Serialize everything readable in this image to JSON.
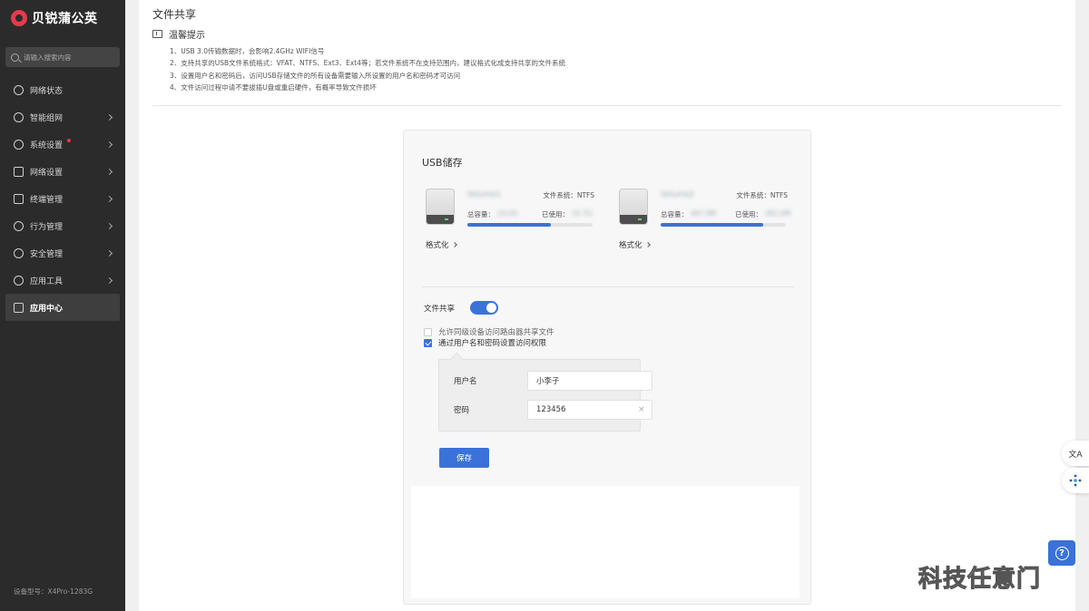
{
  "brand": {
    "name": "贝锐蒲公英"
  },
  "sidebar": {
    "search_placeholder": "请输入搜索内容",
    "items": [
      {
        "label": "网络状态",
        "icon": "globe-icon",
        "arrow": false
      },
      {
        "label": "智能组网",
        "icon": "network-icon",
        "arrow": true
      },
      {
        "label": "系统设置",
        "icon": "gear-icon",
        "arrow": true,
        "badge": true
      },
      {
        "label": "网络设置",
        "icon": "sliders-icon",
        "arrow": true
      },
      {
        "label": "终端管理",
        "icon": "terminal-icon",
        "arrow": true
      },
      {
        "label": "行为管理",
        "icon": "behavior-icon",
        "arrow": true
      },
      {
        "label": "安全管理",
        "icon": "shield-icon",
        "arrow": true
      },
      {
        "label": "应用工具",
        "icon": "tools-icon",
        "arrow": true
      },
      {
        "label": "应用中心",
        "icon": "grid-icon",
        "arrow": false,
        "active": true
      }
    ],
    "device_model": "设备型号：X4Pro-1283G"
  },
  "main": {
    "title": "文件共享",
    "tip_title": "温馨提示",
    "tips": [
      "1、USB 3.0传输数据时，会影响2.4GHz WIFI信号",
      "2、支持共享的USB文件系统格式：VFAT、NTFS、Ext3、Ext4等；若文件系统不在支持范围内，建议格式化成支持共享的文件系统",
      "3、设置用户名和密码后，访问USB存储文件的所有设备需要输入所设置的用户名和密码才可访问",
      "4、文件访问过程中请不要拔插U盘或重启硬件，有概率导致文件损坏"
    ]
  },
  "usb": {
    "title": "USB储存",
    "disks": [
      {
        "name": "Volume1",
        "fs": "文件系统：NTFS",
        "total_label": "总容量：",
        "total": "24.0G",
        "used_label": "已使用：",
        "used": "15.7G",
        "used_ratio": 0.67,
        "format": "格式化"
      },
      {
        "name": "Volume2",
        "fs": "文件系统：NTFS",
        "total_label": "总容量：",
        "total": "467.0M",
        "used_label": "已使用：",
        "used": "381.0M",
        "used_ratio": 0.82,
        "format": "格式化"
      }
    ]
  },
  "share": {
    "label": "文件共享",
    "enabled": true,
    "option_lan": "允许同级设备访问路由器共享文件",
    "option_lan_checked": false,
    "option_auth": "通过用户名和密码设置访问权限",
    "option_auth_checked": true,
    "username_label": "用户名",
    "username": "小李子",
    "password_label": "密码",
    "password": "123456",
    "clear_icon": "×",
    "save_label": "保存"
  },
  "floating": {
    "translate_glyph": "文A",
    "help_glyph": "?"
  },
  "watermark": "科技任意门",
  "colors": {
    "accent": "#3b72d9",
    "sidebar_bg": "#2b2b2b",
    "brand": "#e8394d"
  }
}
